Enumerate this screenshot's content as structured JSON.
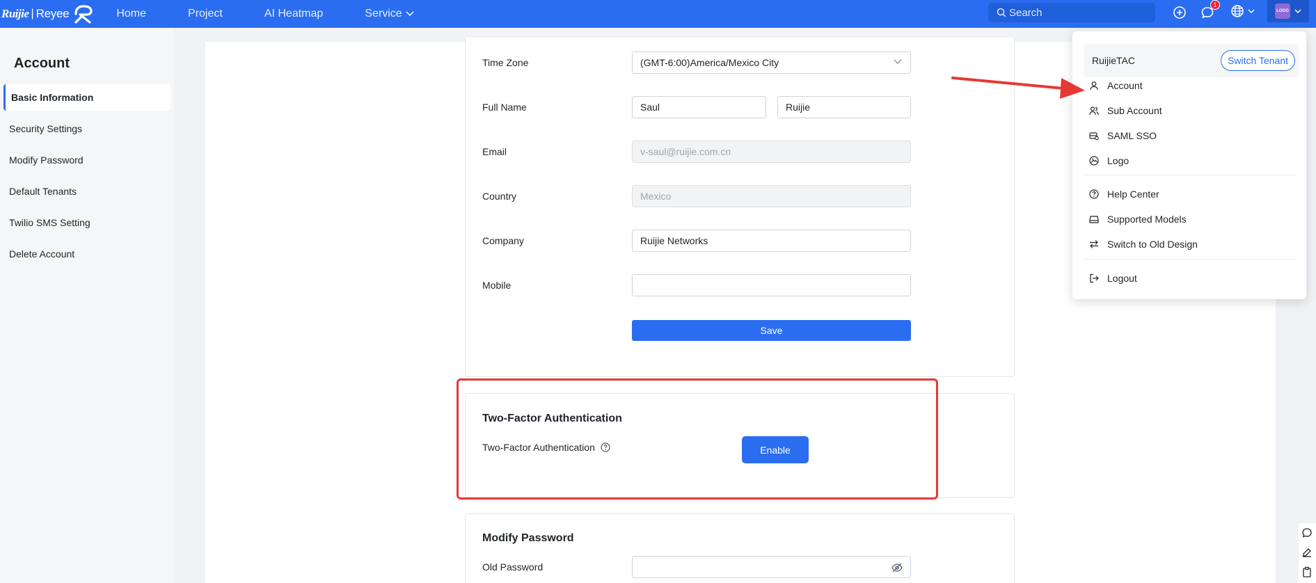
{
  "brand": {
    "name": "Ruijie",
    "product": "Reyee",
    "separator": "|"
  },
  "nav": {
    "items": [
      {
        "label": "Home"
      },
      {
        "label": "Project"
      },
      {
        "label": "AI Heatmap"
      },
      {
        "label": "Service"
      }
    ]
  },
  "search": {
    "placeholder": "Search"
  },
  "notifications": {
    "count": "1"
  },
  "avatar": {
    "text": "LOGO"
  },
  "sidebar": {
    "title": "Account",
    "items": [
      {
        "label": "Basic Information",
        "active": true
      },
      {
        "label": "Security Settings"
      },
      {
        "label": "Modify Password"
      },
      {
        "label": "Default Tenants"
      },
      {
        "label": "Twilio SMS Setting"
      },
      {
        "label": "Delete Account"
      }
    ]
  },
  "basic_info": {
    "time_zone": {
      "label": "Time Zone",
      "value": "(GMT-6:00)America/Mexico City"
    },
    "full_name": {
      "label": "Full Name",
      "first": "Saul",
      "last": "Ruijie"
    },
    "email": {
      "label": "Email",
      "value": "v-saul@ruijie.com.cn"
    },
    "country": {
      "label": "Country",
      "value": "Mexico"
    },
    "company": {
      "label": "Company",
      "value": "Ruijie Networks"
    },
    "mobile": {
      "label": "Mobile",
      "value": ""
    },
    "save_label": "Save"
  },
  "two_factor": {
    "title": "Two-Factor Authentication",
    "label": "Two-Factor Authentication",
    "button": "Enable"
  },
  "modify_password": {
    "title": "Modify Password",
    "old_password_label": "Old Password"
  },
  "dropdown": {
    "tenant": "RuijieTAC",
    "switch_label": "Switch Tenant",
    "items": [
      {
        "label": "Account",
        "icon": "user-icon"
      },
      {
        "label": "Sub Account",
        "icon": "users-icon"
      },
      {
        "label": "SAML SSO",
        "icon": "sso-icon"
      },
      {
        "label": "Logo",
        "icon": "logo-icon"
      },
      {
        "label": "Help Center",
        "icon": "help-icon"
      },
      {
        "label": "Supported Models",
        "icon": "models-icon"
      },
      {
        "label": "Switch to Old Design",
        "icon": "switch-icon"
      },
      {
        "label": "Logout",
        "icon": "logout-icon"
      }
    ]
  },
  "colors": {
    "primary": "#2b6df0",
    "annotation": "#e53935"
  }
}
